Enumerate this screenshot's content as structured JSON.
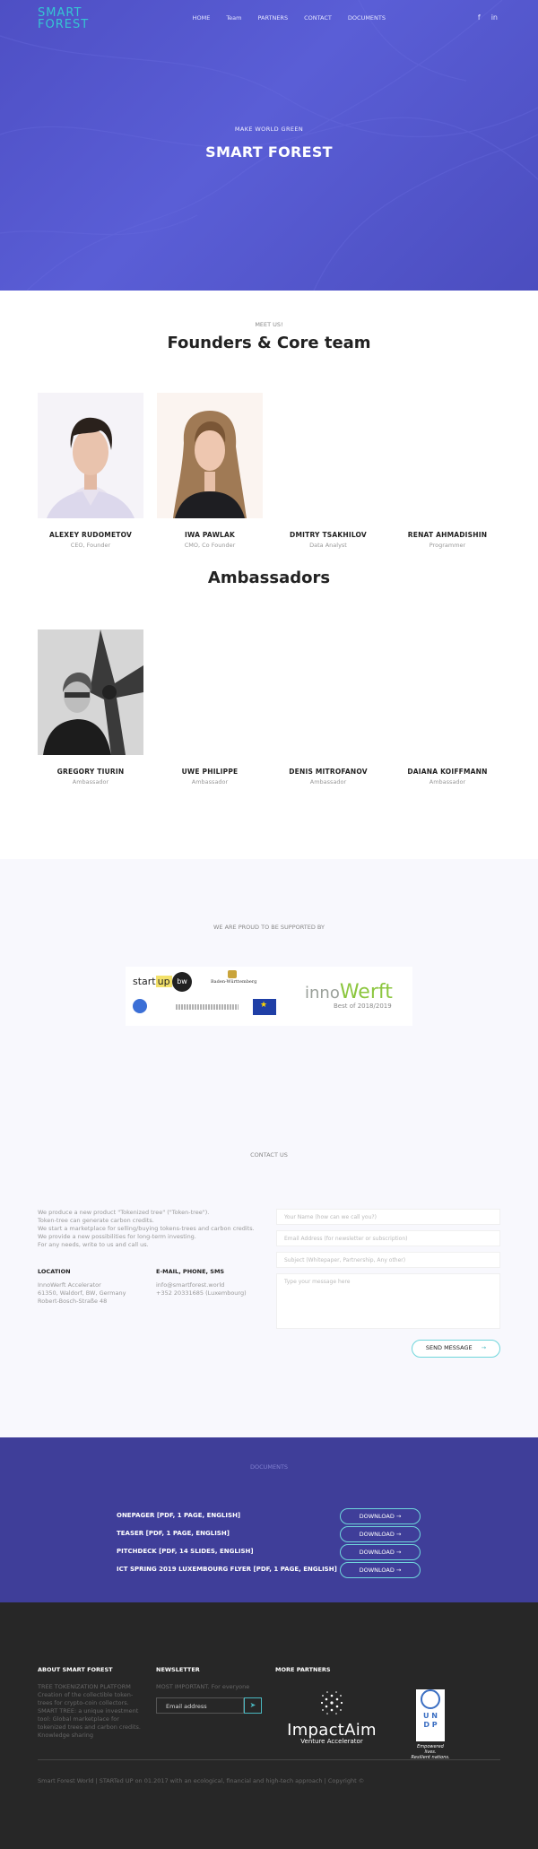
{
  "header": {
    "logo": [
      "SMART",
      "FOREST"
    ],
    "nav": [
      "HOME",
      "Team",
      "PARTNERS",
      "CONTACT",
      "DOCUMENTS"
    ],
    "social": [
      "f",
      "in"
    ]
  },
  "hero": {
    "tagline": "MAKE WORLD GREEN",
    "title": "SMART FOREST"
  },
  "team": {
    "kicker": "MEET US!",
    "title": "Founders & Core team",
    "members": [
      {
        "name": "ALEXEY RUDOMETOV",
        "role": "CEO, Founder"
      },
      {
        "name": "IWA PAWLAK",
        "role": "CMO, Co Founder"
      },
      {
        "name": "DMITRY TSAKHILOV",
        "role": "Data Analyst"
      },
      {
        "name": "RENAT AHMADISHIN",
        "role": "Programmer"
      }
    ]
  },
  "ambassadors": {
    "title": "Ambassadors",
    "members": [
      {
        "name": "GREGORY TIURIN",
        "role": "Ambassador"
      },
      {
        "name": "UWE PHILIPPE",
        "role": "Ambassador"
      },
      {
        "name": "DENIS MITROFANOV",
        "role": "Ambassador"
      },
      {
        "name": "DAIANA KOIFFMANN",
        "role": "Ambassador"
      }
    ]
  },
  "support": {
    "label": "WE ARE PROUD TO BE SUPPORTED BY",
    "startup_a": "start",
    "startup_b": "up",
    "bw": "bw",
    "bawu": "Baden-Württemberg",
    "inno_a": "inno",
    "inno_b": "Werft",
    "inno_best": "Best of 2018/2019"
  },
  "contact": {
    "label": "CONTACT US",
    "intro": [
      "We produce a new product \"Tokenized tree\" (\"Token-tree\").",
      "Token-tree can generate carbon credits.",
      "We start a marketplace for selling/buying tokens-trees and carbon credits.",
      "We provide a new possibilities for long-term investing.",
      "For any needs, write to us and call us."
    ],
    "location_head": "LOCATION",
    "location": [
      "InnoWerft Accelerator",
      "61350, Waldorf, BW, Germany",
      "Robert-Bosch-Straße 48"
    ],
    "email_head": "E-MAIL, PHONE, SMS",
    "email": [
      "info@smartforest.world",
      "+352 20331685 (Luxembourg)"
    ],
    "fields": [
      "Your Name (how can we call you?)",
      "Email Address (for newsletter or subscription)",
      "Subject (Whitepaper, Partnership, Any other)",
      "Type your message here"
    ],
    "send": "SEND MESSAGE",
    "send_arrow": "→"
  },
  "documents": {
    "label": "DOCUMENTS",
    "items": [
      {
        "title": "ONEPAGER [PDF, 1 PAGE, ENGLISH]",
        "button": "DOWNLOAD  →"
      },
      {
        "title": "TEASER [PDF, 1 PAGE, ENGLISH]",
        "button": "DOWNLOAD  →"
      },
      {
        "title": "PITCHDECK [PDF, 14 SLIDES, ENGLISH]",
        "button": "DOWNLOAD  →"
      },
      {
        "title": "ICT SPRING 2019 LUXEMBOURG FLYER [PDF, 1 PAGE, ENGLISH]",
        "button": "DOWNLOAD  →"
      }
    ]
  },
  "footer": {
    "about_head": "ABOUT SMART FOREST",
    "about": [
      "TREE TOKENIZATION PLATFORM",
      "Creation of the collectible token-",
      "trees for crypto-coin collectors.",
      "SMART TREE: a unique investment",
      "tool: Global marketplace for",
      "tokenized trees and carbon credits.",
      "Knowledge sharing"
    ],
    "newsletter_head": "NEWSLETTER",
    "newsletter_text": "MOST IMPORTANT. For everyone",
    "email_placeholder": "Email address",
    "send_icon": "➤",
    "partners_head": "MORE PARTNERS",
    "impact_name": "ImpactAim",
    "impact_sub": "Venture Accelerator",
    "undp_letters": [
      "U N",
      "D P"
    ],
    "undp_sub": [
      "Empowered lives.",
      "Resilient nations."
    ],
    "copyright": "Smart Forest World | STARTed UP on 01.2017 with an ecological, financial and high-tech approach | Copyright ©"
  }
}
